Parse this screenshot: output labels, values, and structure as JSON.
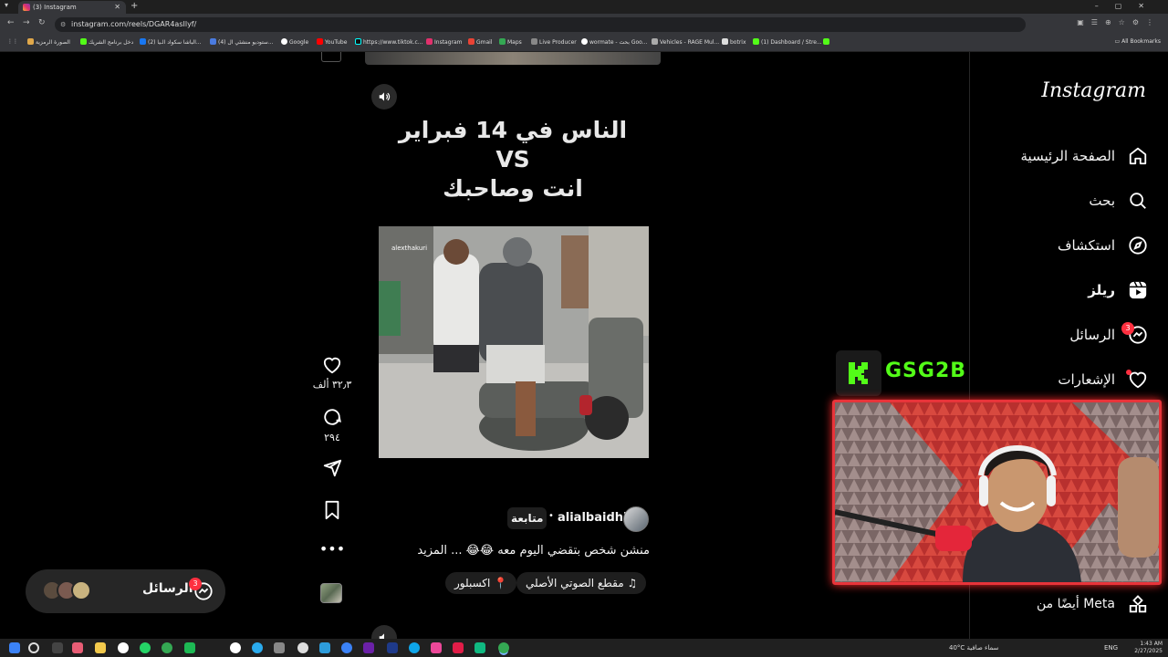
{
  "browser": {
    "tab_title": "(3) Instagram",
    "url": "instagram.com/reels/DGAR4asIlyf/",
    "bookmarks": [
      "الصورة الرمزية",
      "دخل برنامج الشريك",
      "(2) الباشا سكواد الـيا...",
      "(4) ستوديو منشئي ال...",
      "Google",
      "YouTube",
      "https://www.tiktok.c...",
      "Instagram",
      "Gmail",
      "Maps",
      "Live Producer",
      "wormate - بحث Goo...",
      "Vehicles - RAGE Mul...",
      "botrix",
      "(1) Dashboard / Stre..."
    ],
    "all_bookmarks": "All Bookmarks"
  },
  "reel": {
    "title_line1": "الناس في 14 فبراير",
    "title_line2": "VS",
    "title_line3": "انت وصاحبك",
    "video_watermark": "alexthakuri",
    "likes": "٣٢٫٣ ألف",
    "comments": "٢٩٤",
    "author": "alialbaidhi",
    "follow_label": "متابعة",
    "separator": "•",
    "caption": "منشن شخص بتقضي اليوم معه 😂😂 ... المزيد",
    "audio_label": "مقطع الصوتي الأصلي",
    "location_label": "اكسبلور"
  },
  "messages_pill": {
    "label": "الرسائل",
    "badge": "3"
  },
  "sidebar": {
    "logo": "Instagram",
    "items": [
      {
        "label": "الصفحة الرئيسية",
        "icon": "home-icon"
      },
      {
        "label": "بحث",
        "icon": "search-icon"
      },
      {
        "label": "استكشاف",
        "icon": "explore-icon"
      },
      {
        "label": "ريلز",
        "icon": "reels-icon"
      },
      {
        "label": "الرسائل",
        "icon": "messenger-icon",
        "badge": "3"
      },
      {
        "label": "الإشعارات",
        "icon": "heart-icon"
      }
    ],
    "meta_label": "أيضًا من Meta"
  },
  "stream_overlay": {
    "channel": "GSG2B"
  },
  "taskbar": {
    "weather": "40°C سماء صافية",
    "lang": "ENG",
    "time": "1:43 AM",
    "date": "2/27/2025"
  },
  "colors": {
    "badge": "#ff3040",
    "kick_green": "#53fc18",
    "webcam_border": "#e8343a"
  }
}
